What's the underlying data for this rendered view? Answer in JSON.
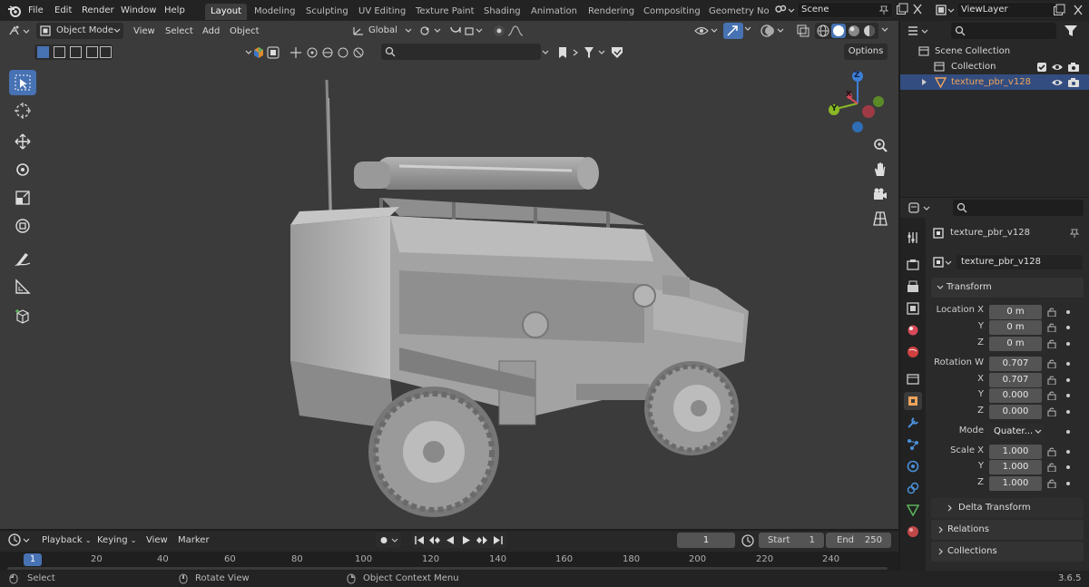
{
  "app": {
    "version": "3.6.5"
  },
  "menus": [
    "File",
    "Edit",
    "Render",
    "Window",
    "Help"
  ],
  "workspaces": [
    "Layout",
    "Modeling",
    "Sculpting",
    "UV Editing",
    "Texture Paint",
    "Shading",
    "Animation",
    "Rendering",
    "Compositing",
    "Geometry Noc"
  ],
  "scene": {
    "name": "Scene"
  },
  "view_layer": {
    "name": "ViewLayer"
  },
  "viewport_header": {
    "mode": "Object Mode",
    "menu": [
      "View",
      "Select",
      "Add",
      "Object"
    ],
    "orientation": "Global",
    "options_label": "Options"
  },
  "outliner": {
    "scene_collection": "Scene Collection",
    "collection": "Collection",
    "object": "texture_pbr_v128"
  },
  "properties": {
    "object_name": "texture_pbr_v128",
    "datablock": "texture_pbr_v128",
    "transform_label": "Transform",
    "location": {
      "label": "Location X",
      "x": "0 m",
      "y": "0 m",
      "z": "0 m"
    },
    "rotation": {
      "label": "Rotation W",
      "w": "0.707",
      "x": "0.707",
      "y": "0.000",
      "z": "0.000"
    },
    "mode": {
      "label": "Mode",
      "value": "Quater..."
    },
    "scale": {
      "label": "Scale X",
      "x": "1.000",
      "y": "1.000",
      "z": "1.000"
    },
    "axis_y": "Y",
    "axis_z": "Z",
    "axis_x": "X",
    "delta_transform": "Delta Transform",
    "relations": "Relations",
    "collections": "Collections"
  },
  "timeline": {
    "menu": [
      "Playback",
      "Keying",
      "View",
      "Marker"
    ],
    "current_frame": "1",
    "start_label": "Start",
    "start": "1",
    "end_label": "End",
    "end": "250",
    "ruler": [
      "1",
      "20",
      "40",
      "60",
      "80",
      "100",
      "120",
      "140",
      "160",
      "180",
      "200",
      "220",
      "240"
    ]
  },
  "statusbar": {
    "select": "Select",
    "rotate_view": "Rotate View",
    "context_menu": "Object Context Menu"
  },
  "gizmo": {
    "x": "X",
    "y": "Y",
    "z": "Z"
  },
  "colors": {
    "accent": "#4772b3",
    "selected_text": "#f0a45a",
    "axis_x": "#d84a5a",
    "axis_y": "#8ab825",
    "axis_z": "#3d7fd6"
  }
}
